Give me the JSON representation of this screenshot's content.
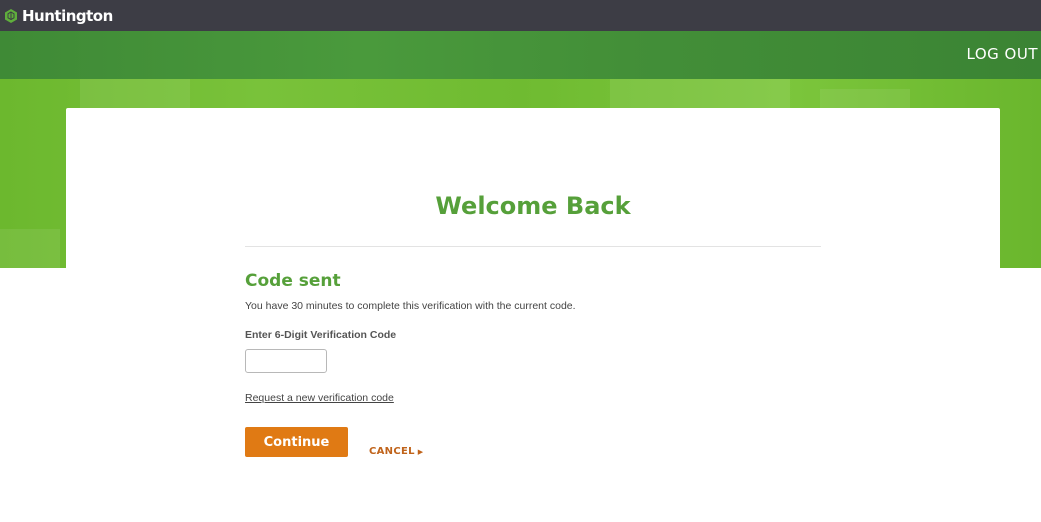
{
  "brand": {
    "name": "Huntington",
    "icon": "hexagon-logo-icon",
    "accent": "#56a03a"
  },
  "nav": {
    "logout_label": "LOG OUT"
  },
  "page": {
    "title": "Welcome Back",
    "subtitle": "Code sent",
    "info_text": "You have 30 minutes to complete this verification with the current code.",
    "code_label": "Enter 6-Digit Verification Code",
    "code_value": "",
    "request_link": "Request a new verification code",
    "continue_label": "Continue",
    "cancel_label": "CANCEL",
    "cancel_icon": "triangle-right-icon"
  },
  "colors": {
    "topbar": "#3d3d45",
    "nav_green": "#438f38",
    "hero_green": "#74be35",
    "button_orange": "#e07a14",
    "cancel_orange": "#c0631a"
  }
}
